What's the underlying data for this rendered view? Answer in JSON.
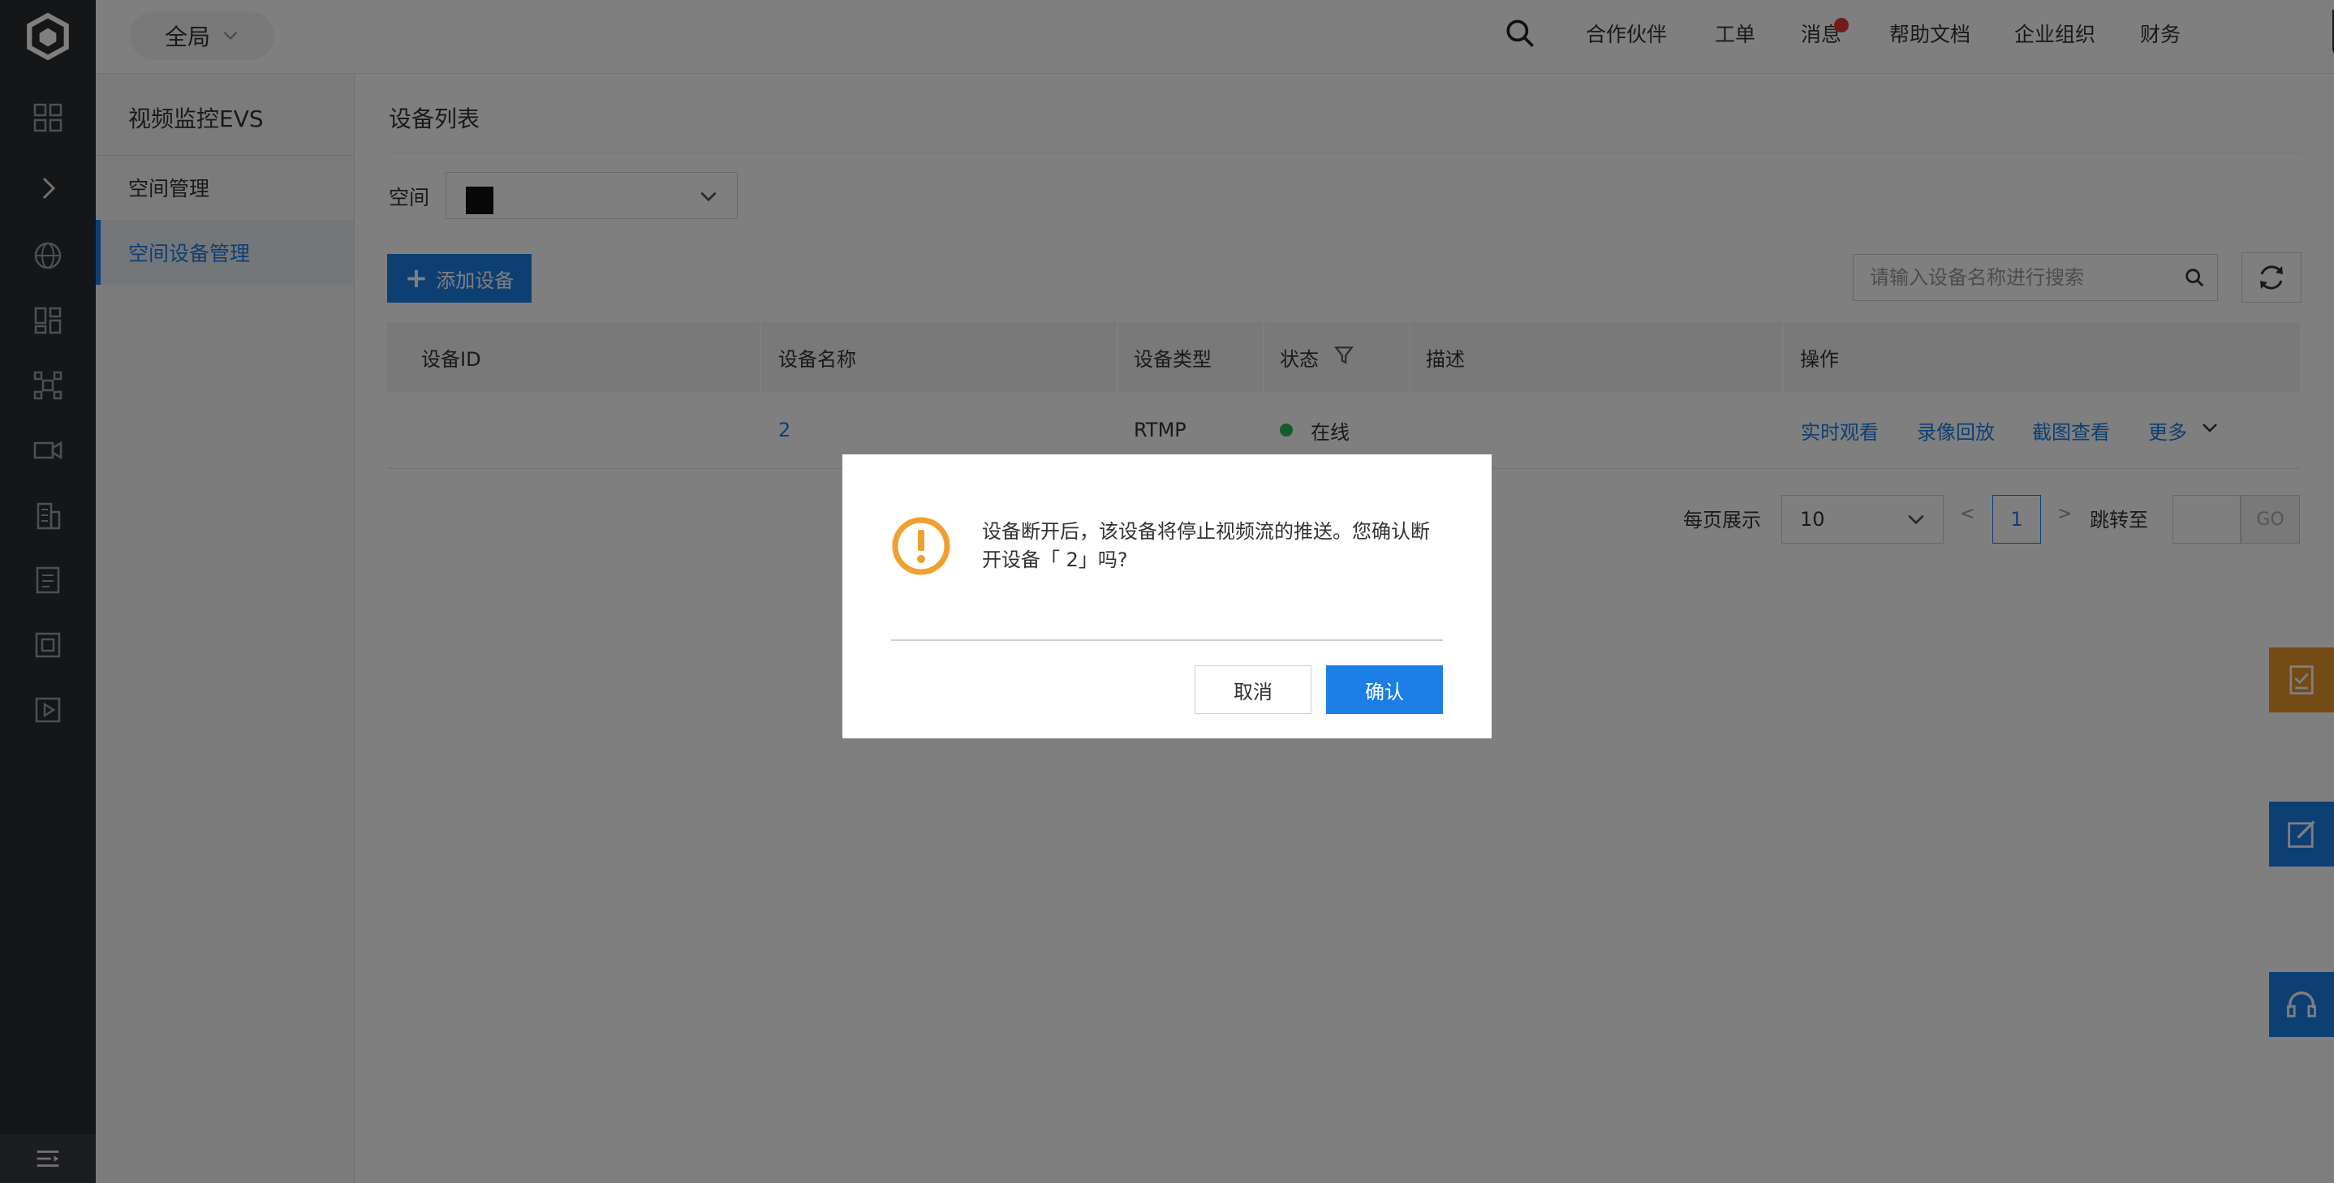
{
  "topbar": {
    "region": "全局",
    "nav": [
      "合作伙伴",
      "工单",
      "消息",
      "帮助文档",
      "企业组织",
      "财务"
    ],
    "colors": {
      "notification_dot": "#e23b3b"
    }
  },
  "sidebar": {
    "product_title": "视频监控EVS",
    "items": [
      {
        "label": "空间管理",
        "active": false
      },
      {
        "label": "空间设备管理",
        "active": true
      }
    ]
  },
  "main": {
    "title": "设备列表",
    "space_label": "空间",
    "add_button": "添加设备",
    "search_placeholder": "请输入设备名称进行搜索",
    "table": {
      "headers": [
        "设备ID",
        "设备名称",
        "设备类型",
        "状态",
        "描述",
        "操作"
      ],
      "rows": [
        {
          "device_id": "",
          "device_name": "2",
          "type": "RTMP",
          "status": "在线",
          "description": "",
          "actions": [
            "实时观看",
            "录像回放",
            "截图查看",
            "更多"
          ]
        }
      ]
    },
    "pagination": {
      "page_size_label": "每页展示",
      "page_size": "10",
      "prev": "<",
      "current_page": "1",
      "next": ">",
      "jump_label": "跳转至",
      "go": "GO"
    }
  },
  "dialog": {
    "message": "设备断开后，该设备将停止视频流的推送。您确认断开设备「      2」吗?",
    "cancel": "取消",
    "confirm": "确认"
  },
  "colors": {
    "accent": "#1a7ee6",
    "online": "#2db55d",
    "warning": "#f0a030",
    "float_orange": "#e8952a",
    "float_blue": "#1a7ee6"
  }
}
